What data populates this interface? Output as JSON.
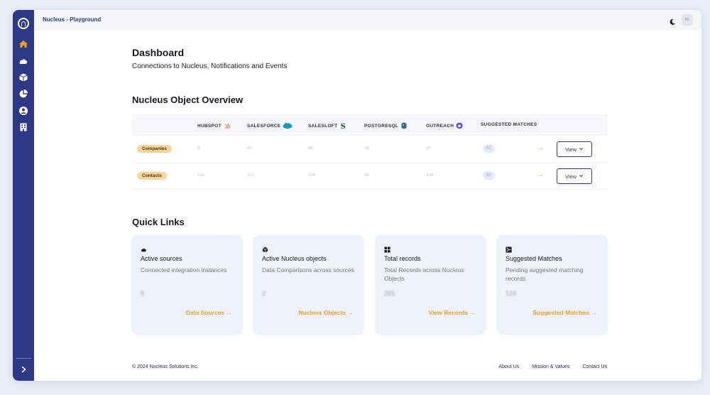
{
  "app": {
    "title": "Nucleus - Playground",
    "avatar_initials": "RE"
  },
  "sidebar": {
    "items": [
      {
        "icon": "home-icon",
        "active": true
      },
      {
        "icon": "cloud-icon"
      },
      {
        "icon": "box-icon"
      },
      {
        "icon": "pie-chart-icon"
      },
      {
        "icon": "user-icon"
      },
      {
        "icon": "building-icon"
      }
    ],
    "expand_icon": "chevron-right-icon"
  },
  "page": {
    "title": "Dashboard",
    "subtitle": "Connections to Nucleus, Notifications and Events"
  },
  "overview": {
    "title": "Nucleus Object Overview",
    "columns": [
      "HUBSPOT",
      "SALESFORCE",
      "SALESLOFT",
      "POSTGRESQL",
      "OUTREACH",
      "SUGGESTED MATCHES"
    ],
    "rows": [
      {
        "label": "Companies",
        "values": [
          "8",
          "97",
          "86",
          "16",
          "20"
        ],
        "matches": "92",
        "view_label": "View"
      },
      {
        "label": "Contacts",
        "values": [
          "153",
          "121",
          "104",
          "36",
          "104"
        ],
        "matches": "92",
        "view_label": "View"
      }
    ]
  },
  "quick_links": {
    "title": "Quick Links",
    "cards": [
      {
        "icon": "cloud-icon",
        "title": "Active sources",
        "desc": "Connected integration instances",
        "value": "5",
        "link": "Data Sources →"
      },
      {
        "icon": "box-icon",
        "title": "Active Nucleus objects",
        "desc": "Data Comparisons across sources",
        "value": "2",
        "link": "Nucleus Objects →"
      },
      {
        "icon": "grid-icon",
        "title": "Total records",
        "desc": "Total Records across Nucleus Objects",
        "value": "265",
        "link": "View Records →"
      },
      {
        "icon": "match-icon",
        "title": "Suggested Matches",
        "desc": "Pending suggested matching records",
        "value": "124",
        "link": "Suggested Matches →"
      }
    ]
  },
  "footer": {
    "copyright": "© 2024 Nucleus Solutions Inc.",
    "links": [
      "About Us",
      "Mission & Values",
      "Contact Us"
    ]
  },
  "colors": {
    "sidebar": "#2c3a86",
    "accent": "#f0a020",
    "pill": "#f9d49b"
  }
}
